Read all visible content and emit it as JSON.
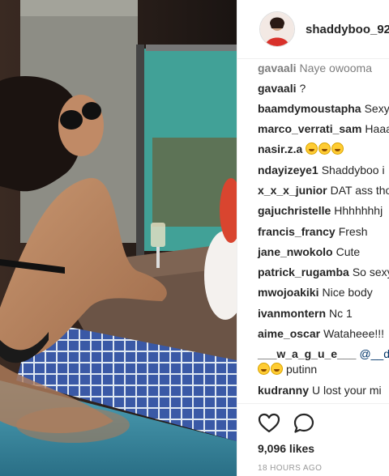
{
  "post": {
    "username": "shaddyboo_92",
    "likes": "9,096 likes",
    "timestamp": "18 HOURS AGO"
  },
  "icons": {
    "like": "heart-outline-icon",
    "comment": "speech-bubble-icon"
  },
  "comments": [
    {
      "user": "gavaali",
      "text": "Naye owooma"
    },
    {
      "user": "gavaali",
      "text": "?"
    },
    {
      "user": "baamdymoustapha",
      "text": "Sexy"
    },
    {
      "user": "marco_verrati_sam",
      "text": "Haaa"
    },
    {
      "user": "nasir.z.a",
      "text": ""
    },
    {
      "user": "ndayizeye1",
      "text": "Shaddyboo i"
    },
    {
      "user": "x_x_x_junior",
      "text": "DAT ass tho"
    },
    {
      "user": "gajuchristelle",
      "text": "Hhhhhhhj"
    },
    {
      "user": "francis_francy",
      "text": "Fresh"
    },
    {
      "user": "jane_nwokolo",
      "text": "Cute"
    },
    {
      "user": "patrick_rugamba",
      "text": "So sexy"
    },
    {
      "user": "mwojoakiki",
      "text": "Nice body"
    },
    {
      "user": "ivanmontern",
      "text": "Nc 1"
    },
    {
      "user": "aime_oscar",
      "text": "Wataheee!!!"
    },
    {
      "user": "___w_a_g_u_e___",
      "text": "@__d"
    },
    {
      "user": "",
      "text": "putinn"
    },
    {
      "user": "kudranny",
      "text": "U lost your mi"
    }
  ]
}
